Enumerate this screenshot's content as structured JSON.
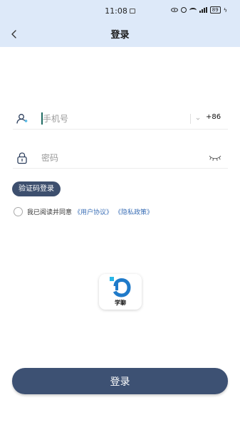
{
  "status_bar": {
    "time": "11:08",
    "battery": "89",
    "icons": [
      "eye-icon",
      "alarm-icon",
      "wifi-icon",
      "signal-icon",
      "battery-icon",
      "charging-icon"
    ]
  },
  "nav": {
    "back_icon": "chevron-left-icon",
    "title": "登录"
  },
  "phone_field": {
    "placeholder": "手机号",
    "value": "",
    "country_code": "+86",
    "icon": "user-icon"
  },
  "password_field": {
    "placeholder": "密码",
    "value": "",
    "icon": "lock-icon",
    "toggle_icon": "eye-closed-icon"
  },
  "sms_login_label": "验证码登录",
  "agreement": {
    "text": "我已阅读并同意",
    "user_agreement": "《用户协议》",
    "privacy_policy": "《隐私政策》",
    "checked": false
  },
  "app_logo": {
    "name": "学聊",
    "accent_color": "#1f7ac9",
    "accent_color_2": "#29b6e6"
  },
  "login_button_label": "登录",
  "colors": {
    "header_bg": "#dde9f9",
    "primary_button": "#3d5173",
    "link": "#3b6fb6"
  }
}
